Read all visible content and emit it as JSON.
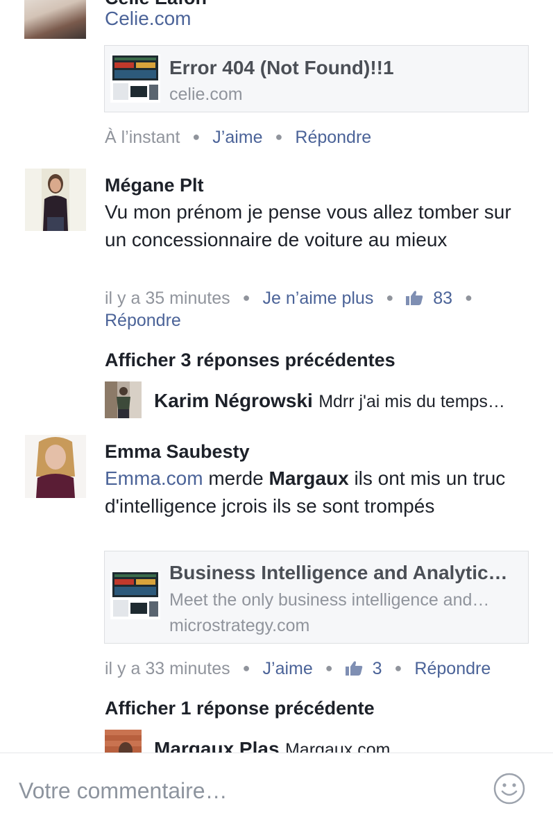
{
  "comments": [
    {
      "author": "Celie Eafon",
      "link_text": "Celie.com",
      "card": {
        "title": "Error 404 (Not Found)!!1",
        "domain": "celie.com"
      },
      "time": "À l’instant",
      "like": "J’aime",
      "reply": "Répondre"
    },
    {
      "author": "Mégane Plt",
      "text": "Vu mon prénom je pense vous allez tomber sur un concessionnaire de voiture au mieux",
      "time": "il y a 35 minutes",
      "like": "Je n’aime plus",
      "like_count": "83",
      "reply": "Répondre",
      "show_replies": "Afficher 3 réponses précédentes",
      "reply_preview": {
        "author": "Karim Négrowski",
        "text": "Mdrr j'ai mis du temps…"
      }
    },
    {
      "author": "Emma Saubesty",
      "link_text": "Emma.com",
      "text_a": "merde",
      "mention": "Margaux",
      "text_b": "ils ont mis un truc d'intelligence jcrois ils se sont trompés",
      "card": {
        "title": "Business Intelligence and Analytic…",
        "description": "Meet the only business intelligence and…",
        "domain": "microstrategy.com"
      },
      "time": "il y a 33 minutes",
      "like": "J’aime",
      "like_count": "3",
      "reply": "Répondre",
      "show_replies": "Afficher 1 réponse précédente",
      "reply_preview": {
        "author": "Margaux Plas",
        "text": "Margaux.com"
      }
    }
  ],
  "composer": {
    "placeholder": "Votre commentaire…"
  },
  "colors": {
    "link": "#4b6398",
    "meta": "#90949c",
    "text": "#1d2129",
    "card_bg": "#f6f7f9"
  },
  "icons": {
    "like": "thumbs-up-icon",
    "emoji": "smiley-icon"
  }
}
